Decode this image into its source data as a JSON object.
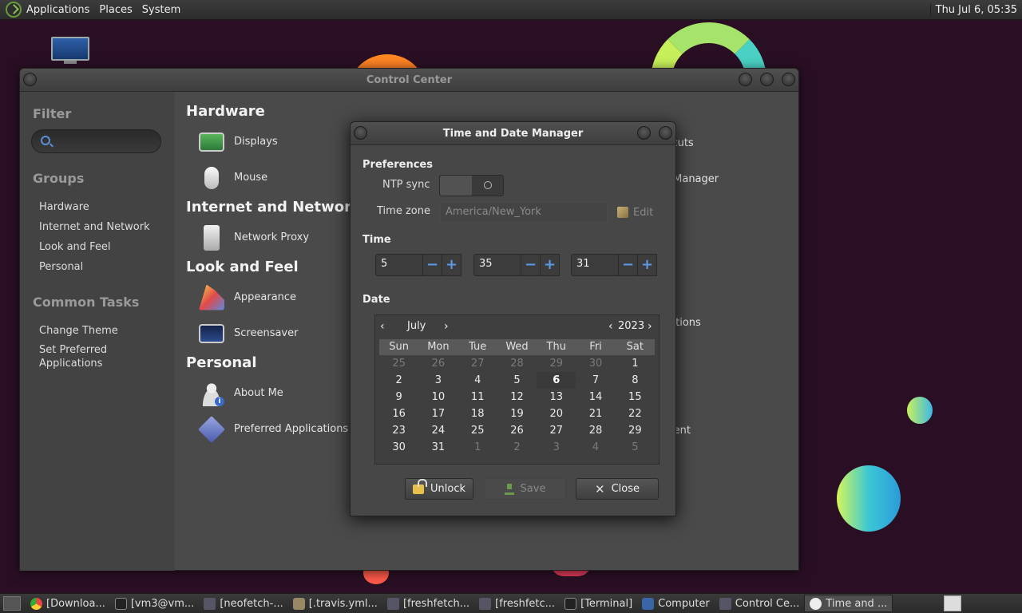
{
  "top_panel": {
    "menus": [
      "Applications",
      "Places",
      "System"
    ],
    "clock": "Thu Jul  6, 05:35"
  },
  "control_center": {
    "title": "Control Center",
    "sidebar": {
      "filter_heading": "Filter",
      "search_placeholder": "",
      "groups_heading": "Groups",
      "groups": [
        "Hardware",
        "Internet and Network",
        "Look and Feel",
        "Personal"
      ],
      "tasks_heading": "Common Tasks",
      "tasks": [
        "Change Theme",
        "Set Preferred Applications"
      ]
    },
    "categories": {
      "hardware": {
        "title": "Hardware",
        "items": [
          "Displays",
          "Mouse"
        ]
      },
      "internet": {
        "title": "Internet and Network",
        "items": [
          "Network Proxy"
        ]
      },
      "look": {
        "title": "Look and Feel",
        "items": [
          "Appearance",
          "Screensaver"
        ]
      },
      "personal": {
        "title": "Personal",
        "items": [
          "About Me",
          "Preferred Applications"
        ]
      }
    },
    "partial_right": [
      "rtcuts",
      "e Manager",
      "cations",
      "ment"
    ]
  },
  "time_dialog": {
    "title": "Time and Date Manager",
    "preferences_heading": "Preferences",
    "ntp_label": "NTP sync",
    "ntp_enabled": false,
    "timezone_label": "Time zone",
    "timezone_value": "America/New_York",
    "edit_label": "Edit",
    "time_heading": "Time",
    "hour": "5",
    "minute": "35",
    "second": "31",
    "spin_minus": "−",
    "spin_plus": "+",
    "date_heading": "Date",
    "month": "July",
    "year": "2023",
    "weekdays": [
      "Sun",
      "Mon",
      "Tue",
      "Wed",
      "Thu",
      "Fri",
      "Sat"
    ],
    "weeks": [
      [
        "25",
        "26",
        "27",
        "28",
        "29",
        "30",
        "1"
      ],
      [
        "2",
        "3",
        "4",
        "5",
        "6",
        "7",
        "8"
      ],
      [
        "9",
        "10",
        "11",
        "12",
        "13",
        "14",
        "15"
      ],
      [
        "16",
        "17",
        "18",
        "19",
        "20",
        "21",
        "22"
      ],
      [
        "23",
        "24",
        "25",
        "26",
        "27",
        "28",
        "29"
      ],
      [
        "30",
        "31",
        "1",
        "2",
        "3",
        "4",
        "5"
      ]
    ],
    "selected_day": "6",
    "unlock_label": "Unlock",
    "save_label": "Save",
    "close_label": "Close"
  },
  "taskbar": {
    "items": [
      {
        "label": "[Downloa...",
        "icon": "chrome-icon"
      },
      {
        "label": "[vm3@vm...",
        "icon": "terminal-icon"
      },
      {
        "label": "[neofetch-...",
        "icon": "file-manager-icon"
      },
      {
        "label": "[.travis.yml...",
        "icon": "text-editor-icon"
      },
      {
        "label": "[freshfetch...",
        "icon": "file-manager-icon"
      },
      {
        "label": "[freshfetc...",
        "icon": "file-manager-icon"
      },
      {
        "label": "[Terminal]",
        "icon": "terminal-icon"
      },
      {
        "label": "Computer",
        "icon": "computer-icon"
      },
      {
        "label": "Control Ce...",
        "icon": "control-center-icon"
      },
      {
        "label": "Time and ...",
        "icon": "clock-icon"
      }
    ]
  }
}
